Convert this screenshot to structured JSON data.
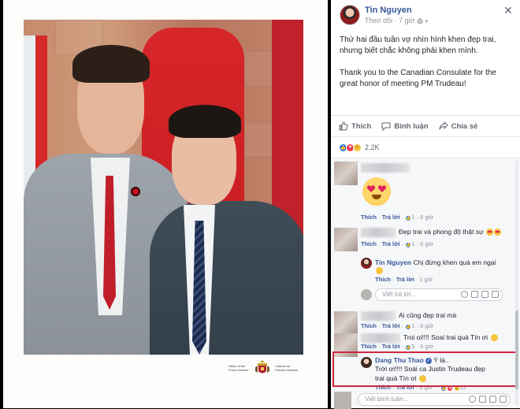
{
  "post": {
    "author": "Tin Nguyen",
    "follow_label": "Theo dõi",
    "dot": "·",
    "time": "7 giờ",
    "text_line1": "Thứ hai đầu tuần vợ nhìn hình khen đẹp trai, nhưng biết chắc không phải khen mình.",
    "text_line2": "Thank you to the Canadian Consulate for the great honor of meeting PM Trudeau!",
    "close_glyph": "✕"
  },
  "actions": {
    "like": "Thích",
    "comment": "Bình luận",
    "share": "Chia sẻ"
  },
  "reactions": {
    "count": "2,2K"
  },
  "photo": {
    "caption_left": "Office of the Prime Minister",
    "caption_right": "Cabinet du Premier Ministre"
  },
  "comments": {
    "c1": {
      "like": "Thích",
      "reply": "Trả lời",
      "count": "1",
      "time": "6 giờ"
    },
    "c2": {
      "text": "Đẹp trai và phong độ thật sự",
      "like": "Thích",
      "reply": "Trả lời",
      "count": "1",
      "time": "6 giờ"
    },
    "r1": {
      "name": "Tin Nguyen",
      "text": "Chị đừng khen quá em ngại",
      "like": "Thích",
      "reply": "Trả lời",
      "time": "1 giờ"
    },
    "reply_placeholder_1": "Viết trả lời...",
    "c3": {
      "text": "Ai cũng đẹp trai mà",
      "like": "Thích",
      "reply": "Trả lời",
      "count": "1",
      "time": "6 giờ"
    },
    "c4": {
      "text": "Troi oi!!!! Soai trai quá Tín ơi",
      "like": "Thích",
      "reply": "Trả lời",
      "count": "5",
      "time": "6 giờ"
    },
    "c5": {
      "name": "Dang Thu Thao",
      "text1": "Ý là..",
      "text2": "Trời ơi!!!! Soái ca Justin Trudeau đẹp trai quá Tín ơi",
      "like": "Thích",
      "reply": "Trả lời",
      "time": "6 giờ",
      "count": "22"
    },
    "write_placeholder": "Viết bình luận..."
  },
  "colors": {
    "link": "#365899",
    "highlight": "#d0273f"
  }
}
